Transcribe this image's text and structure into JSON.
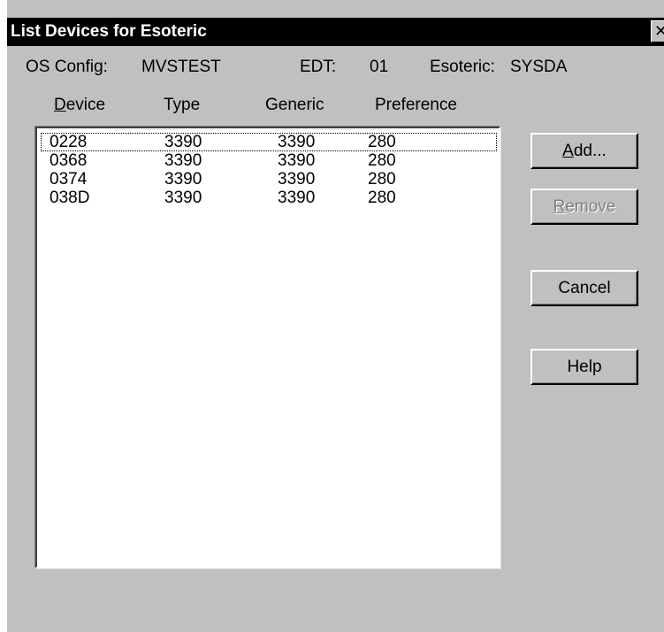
{
  "window": {
    "title": "List Devices for Esoteric",
    "close_glyph": "✕"
  },
  "info": {
    "os_config_label": "OS Config:",
    "os_config_value": "MVSTEST",
    "edt_label": "EDT:",
    "edt_value": "01",
    "esoteric_label": "Esoteric:",
    "esoteric_value": "SYSDA"
  },
  "columns": {
    "device_mnemonic": "D",
    "device_rest": "evice",
    "type": "Type",
    "generic": "Generic",
    "preference": "Preference"
  },
  "devices": [
    {
      "device": "0228",
      "type": "3390",
      "generic": "3390",
      "preference": "280"
    },
    {
      "device": "0368",
      "type": "3390",
      "generic": "3390",
      "preference": "280"
    },
    {
      "device": "0374",
      "type": "3390",
      "generic": "3390",
      "preference": "280"
    },
    {
      "device": "038D",
      "type": "3390",
      "generic": "3390",
      "preference": "280"
    }
  ],
  "buttons": {
    "add_mnemonic": "A",
    "add_rest": "dd...",
    "remove_mnemonic": "R",
    "remove_rest": "emove",
    "cancel": "Cancel",
    "help": "Help"
  },
  "colors": {
    "face": "#c0c0c0",
    "titlebar": "#000000",
    "disabled_text": "#808080"
  }
}
